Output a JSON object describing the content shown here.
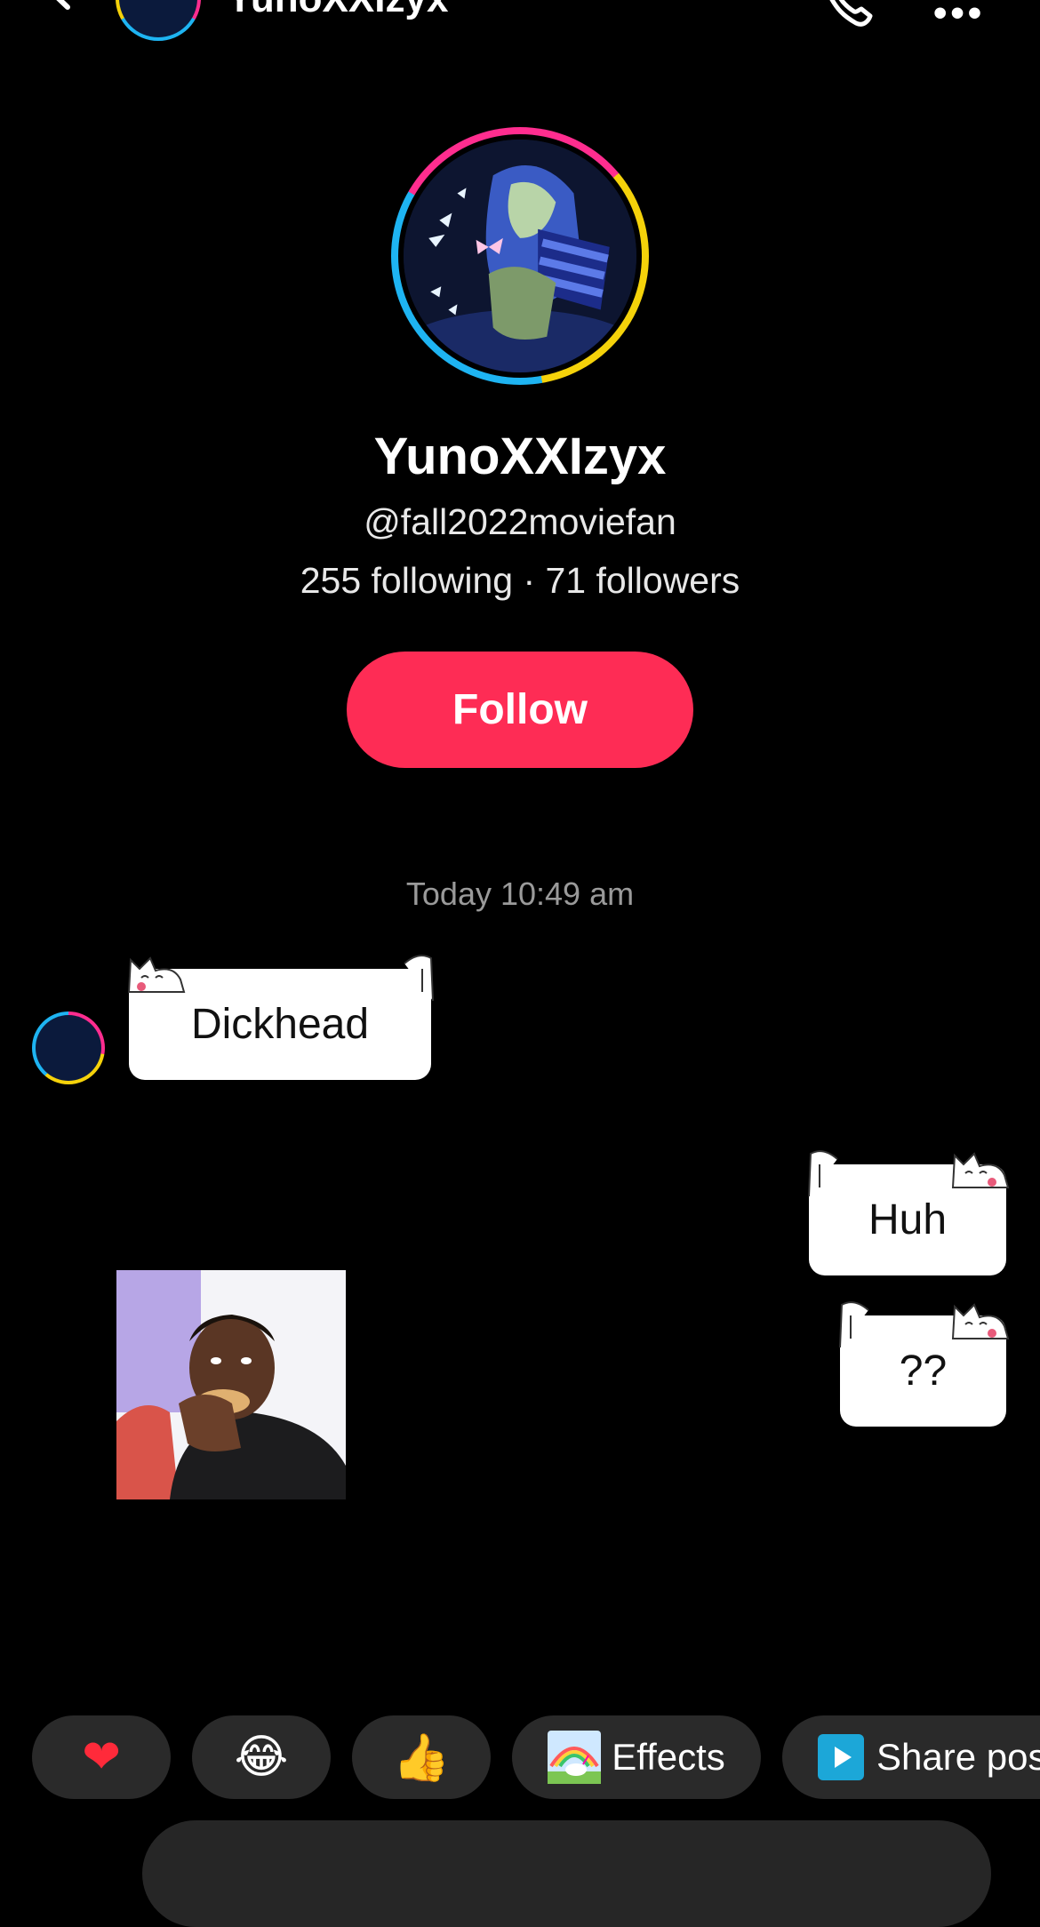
{
  "header": {
    "title": "YunoXXIzyx",
    "back_icon": "chevron-left-icon",
    "call_icon": "phone-icon",
    "more_icon": "more-icon"
  },
  "profile": {
    "display_name": "YunoXXIzyx",
    "handle": "@fall2022moviefan",
    "stats": "255 following · 71 followers",
    "follow_label": "Follow"
  },
  "colors": {
    "follow_button": "#fe2c55",
    "ring_pink": "#ff2d8f",
    "ring_yellow": "#f5d20a",
    "ring_blue": "#1eb4f2",
    "chip_bg": "#2a2a2a"
  },
  "conversation": {
    "timestamp": "Today 10:49 am",
    "messages": [
      {
        "from": "them",
        "type": "text",
        "text": "Dickhead"
      },
      {
        "from": "me",
        "type": "text",
        "text": "Huh"
      },
      {
        "from": "me",
        "type": "text",
        "text": "??"
      },
      {
        "from": "them",
        "type": "image"
      }
    ]
  },
  "quick_actions": {
    "heart": "❤",
    "laugh": "😂",
    "thumb": "👍",
    "effects_label": "Effects",
    "share_label": "Share pos"
  }
}
